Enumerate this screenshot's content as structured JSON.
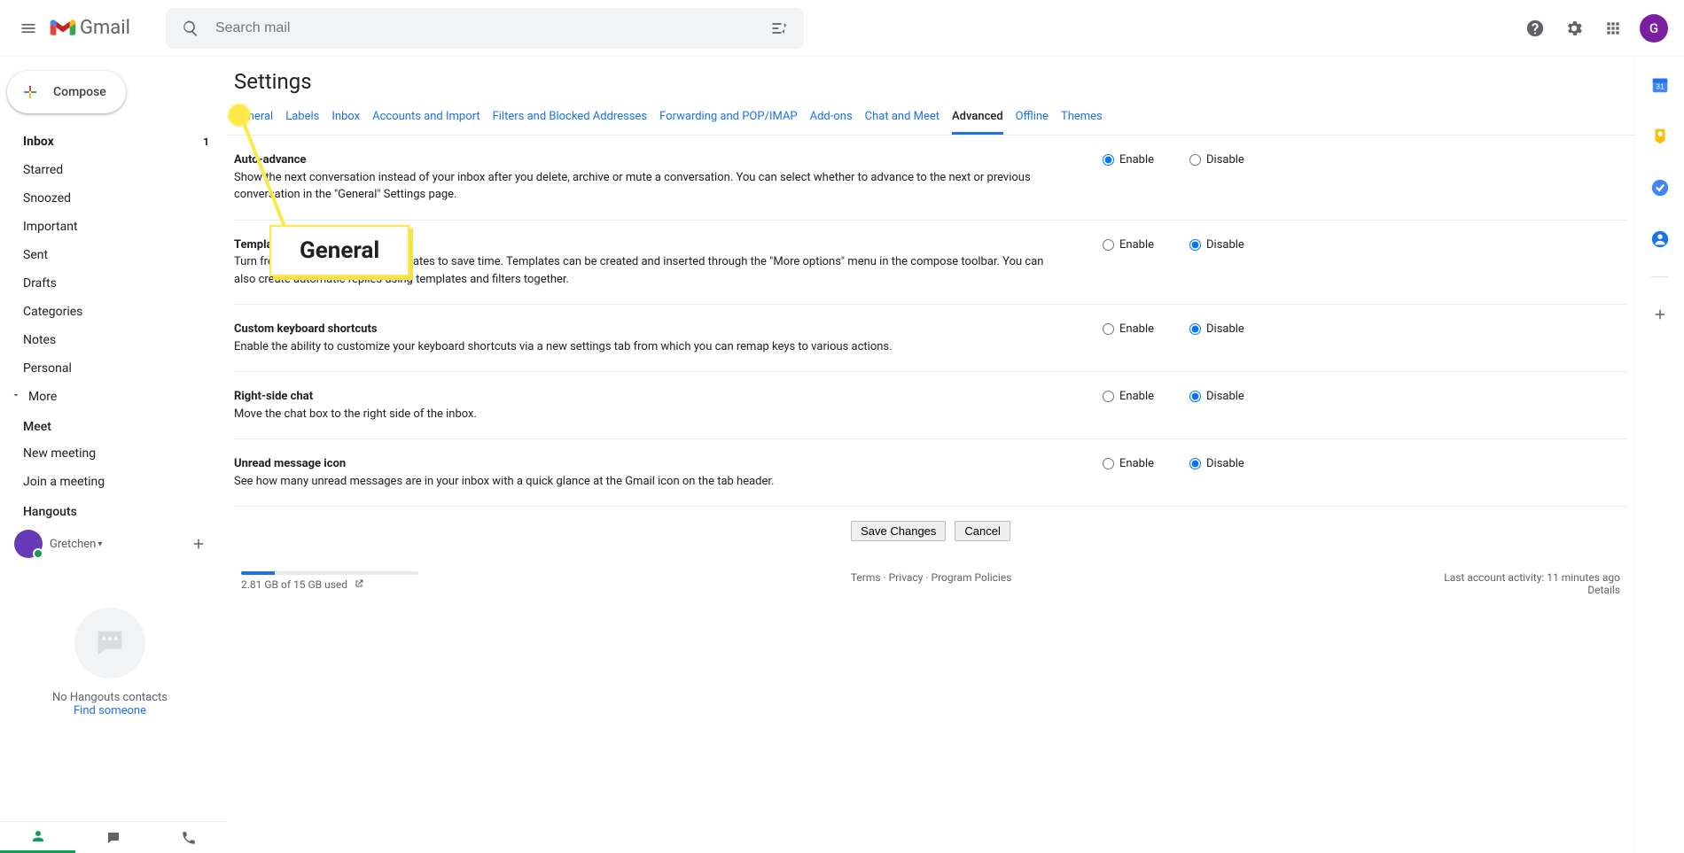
{
  "topbar": {
    "product_name": "Gmail",
    "search_placeholder": "Search mail",
    "avatar_initial": "G"
  },
  "sidebar": {
    "compose_label": "Compose",
    "inbox": {
      "label": "Inbox",
      "count": "1"
    },
    "items": [
      "Starred",
      "Snoozed",
      "Important",
      "Sent",
      "Drafts",
      "Categories",
      "Notes",
      "Personal"
    ],
    "more_label": "More",
    "meet_label": "Meet",
    "meet_items": [
      "New meeting",
      "Join a meeting"
    ],
    "hangouts_label": "Hangouts",
    "hangouts_user": "Gretchen",
    "hangouts_empty": "No Hangouts contacts",
    "find_someone": "Find someone"
  },
  "settings": {
    "page_title": "Settings",
    "tabs": [
      "General",
      "Labels",
      "Inbox",
      "Accounts and Import",
      "Filters and Blocked Addresses",
      "Forwarding and POP/IMAP",
      "Add-ons",
      "Chat and Meet",
      "Advanced",
      "Offline",
      "Themes"
    ],
    "active_tab": "Advanced",
    "enable_label": "Enable",
    "disable_label": "Disable",
    "save_label": "Save Changes",
    "cancel_label": "Cancel",
    "rows": [
      {
        "title": "Auto-advance",
        "desc": "Show the next conversation instead of your inbox after you delete, archive or mute a conversation. You can select whether to advance to the next or previous conversation in the \"General\" Settings page.",
        "value": "enable"
      },
      {
        "title": "Templates",
        "desc": "Turn frequent messages into templates to save time. Templates can be created and inserted through the \"More options\" menu in the compose toolbar. You can also create automatic replies using templates and filters together.",
        "value": "disable"
      },
      {
        "title": "Custom keyboard shortcuts",
        "desc": "Enable the ability to customize your keyboard shortcuts via a new settings tab from which you can remap keys to various actions.",
        "value": "disable"
      },
      {
        "title": "Right-side chat",
        "desc": "Move the chat box to the right side of the inbox.",
        "value": "disable"
      },
      {
        "title": "Unread message icon",
        "desc": "See how many unread messages are in your inbox with a quick glance at the Gmail icon on the tab header.",
        "value": "disable"
      }
    ]
  },
  "callout": {
    "label": "General"
  },
  "footer": {
    "terms": "Terms",
    "privacy": "Privacy",
    "policies": "Program Policies",
    "storage_line": "2.81 GB of 15 GB used",
    "activity_line": "Last account activity: 11 minutes ago",
    "details": "Details"
  }
}
